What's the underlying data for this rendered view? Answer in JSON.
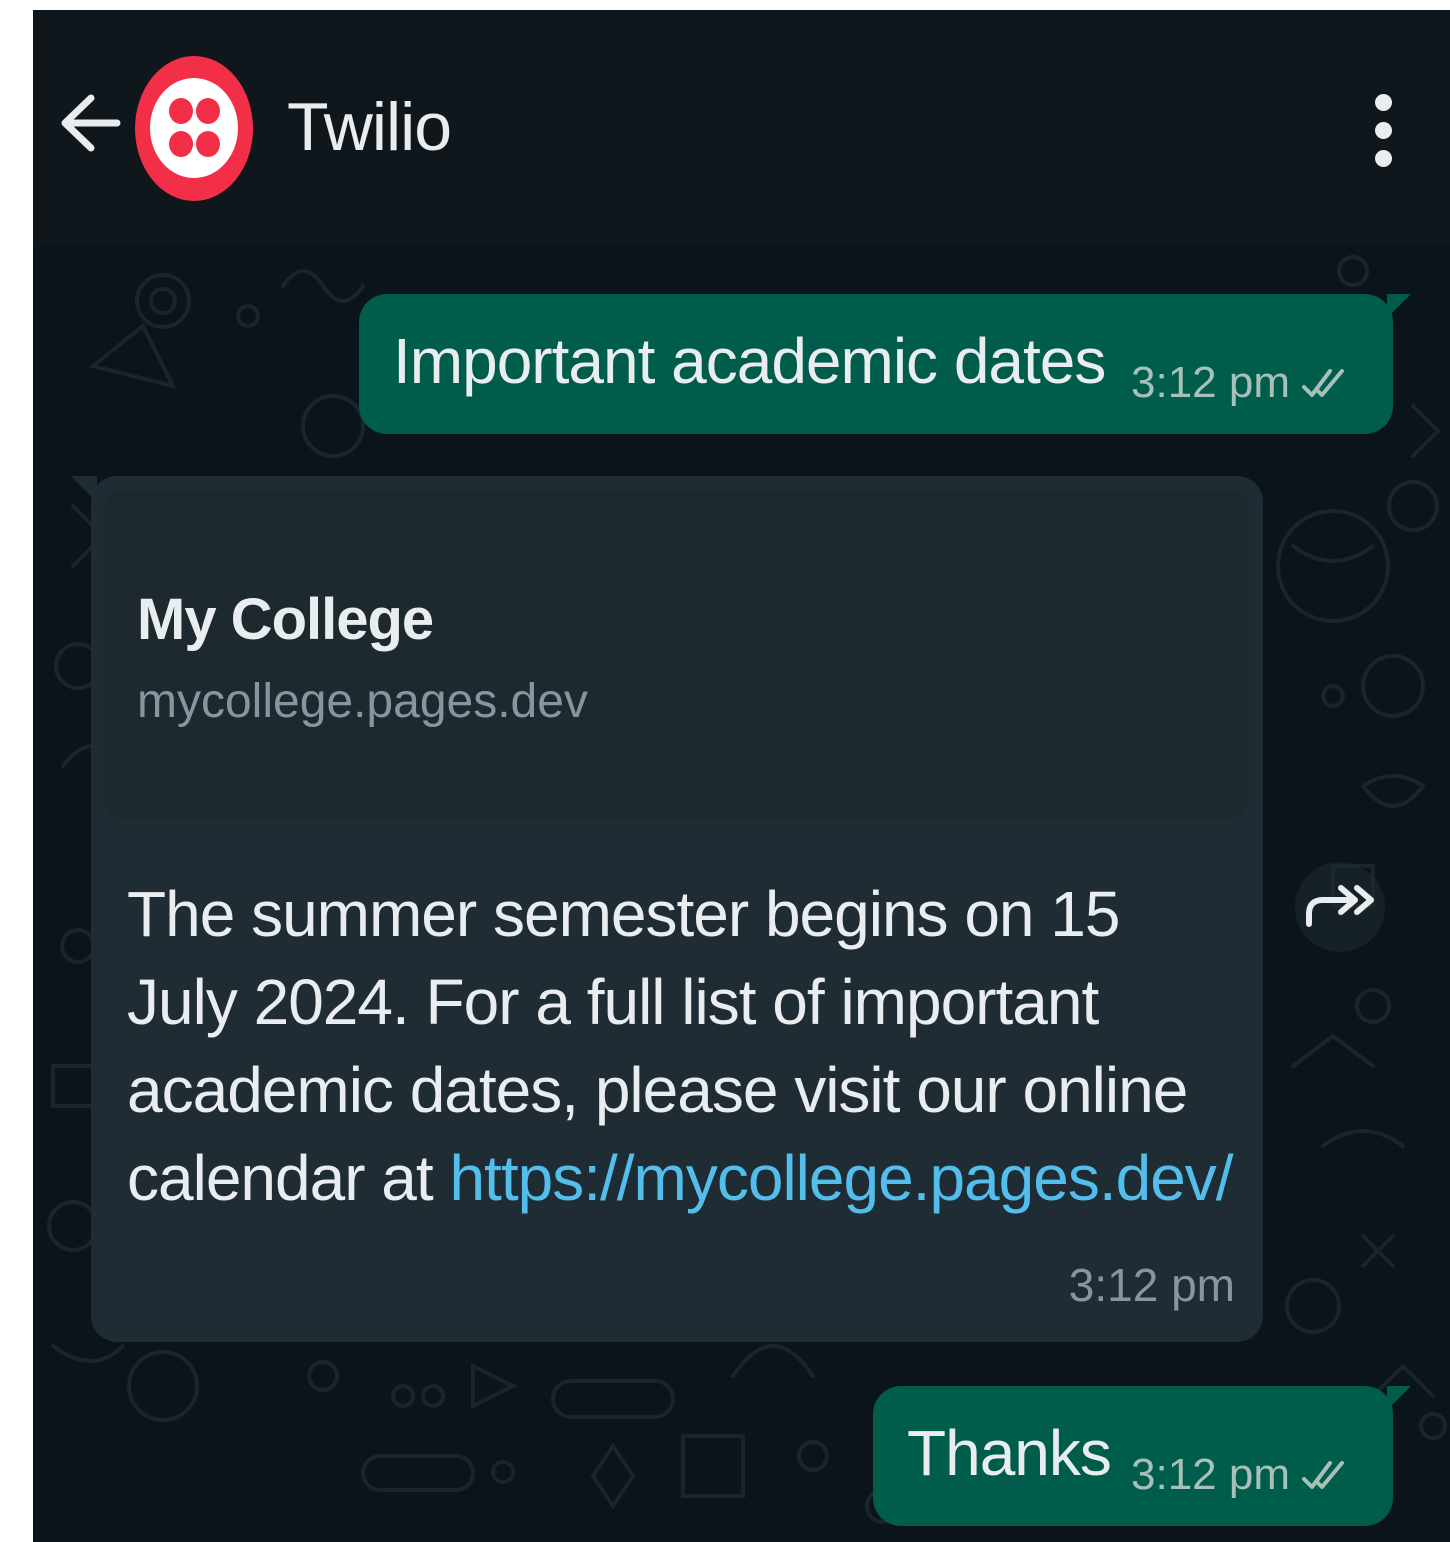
{
  "header": {
    "contact_name": "Twilio",
    "avatar_color": "#f22f46",
    "back_icon": "arrow-left-icon",
    "menu_icon": "more-vertical-icon"
  },
  "messages": [
    {
      "direction": "outgoing",
      "text": "Important academic dates",
      "time": "3:12 pm",
      "status_icon": "double-check-icon"
    },
    {
      "direction": "incoming",
      "link_preview": {
        "title": "My College",
        "domain": "mycollege.pages.dev"
      },
      "text": "The summer semester begins on 15 July 2024. For a full list of important academic dates, please visit our online calendar at",
      "link": "https://mycollege.pages.dev/",
      "time": "3:12 pm",
      "action_icon": "forward-icon"
    },
    {
      "direction": "outgoing",
      "text": "Thanks",
      "time": "3:12 pm",
      "status_icon": "double-check-icon"
    }
  ],
  "colors": {
    "chat_background": "#0b141a",
    "header_background": "#0f171c",
    "outgoing_bubble": "#005c4b",
    "incoming_bubble": "#1f2c34",
    "link": "#53bdeb"
  }
}
